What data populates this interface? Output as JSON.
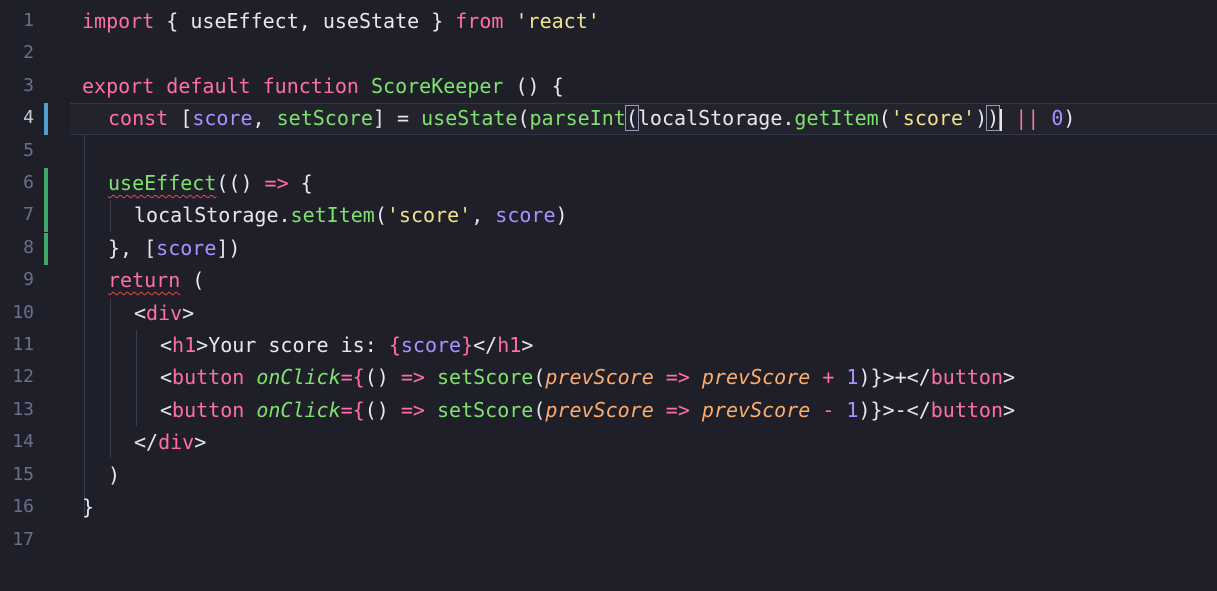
{
  "editor": {
    "lines": [
      {
        "n": "1"
      },
      {
        "n": "2"
      },
      {
        "n": "3"
      },
      {
        "n": "4"
      },
      {
        "n": "5"
      },
      {
        "n": "6"
      },
      {
        "n": "7"
      },
      {
        "n": "8"
      },
      {
        "n": "9"
      },
      {
        "n": "10"
      },
      {
        "n": "11"
      },
      {
        "n": "12"
      },
      {
        "n": "13"
      },
      {
        "n": "14"
      },
      {
        "n": "15"
      },
      {
        "n": "16"
      },
      {
        "n": "17"
      }
    ],
    "code": {
      "l1": {
        "import": "import",
        "p1": " { ",
        "useEffect": "useEffect",
        "comma": ", ",
        "useState": "useState",
        "p2": " } ",
        "from": "from",
        "sp": " ",
        "react": "'react'"
      },
      "l3": {
        "export": "export",
        "default": "default",
        "function": "function",
        "name": "ScoreKeeper",
        "parens": " () {"
      },
      "l4": {
        "const": "const",
        "open": " [",
        "score": "score",
        "comma": ", ",
        "setScore": "setScore",
        "close": "] = ",
        "useState": "useState",
        "paren1": "(",
        "parseInt": "parseInt",
        "paren2": "(",
        "localStorage": "localStorage",
        "dot": ".",
        "getItem": "getItem",
        "paren3": "(",
        "key": "'score'",
        "paren4": ")",
        "paren5": ")",
        "or": " || ",
        "zero": "0",
        "paren6": ")"
      },
      "l6": {
        "useEffect": "useEffect",
        "rest": "(() ",
        "arrow": "=>",
        "brace": " {"
      },
      "l7": {
        "localStorage": "localStorage",
        "dot": ".",
        "setItem": "setItem",
        "p1": "(",
        "key": "'score'",
        "comma": ", ",
        "score": "score",
        "p2": ")"
      },
      "l8": {
        "p1": "}, [",
        "score": "score",
        "p2": "])"
      },
      "l9": {
        "return": "return",
        "rest": " ("
      },
      "l10": {
        "lt": "<",
        "div": "div",
        "gt": ">"
      },
      "l11": {
        "lt": "<",
        "h1": "h1",
        "gt": ">",
        "text": "Your score is: ",
        "b1": "{",
        "score": "score",
        "b2": "}",
        "lt2": "</",
        "h1c": "h1",
        "gt2": ">"
      },
      "l12": {
        "lt": "<",
        "button": "button",
        "sp": " ",
        "onClick": "onClick",
        "eq": "={",
        "paren": "() ",
        "arrow": "=>",
        "sp2": " ",
        "setScore": "setScore",
        "p1": "(",
        "prev1": "prevScore",
        "arrow2": " => ",
        "prev2": "prevScore",
        "op": " + ",
        "one": "1",
        "p2": ")}",
        "gt": ">",
        "label": "+",
        "lt2": "</",
        "buttonc": "button",
        "gt2": ">"
      },
      "l13": {
        "lt": "<",
        "button": "button",
        "sp": " ",
        "onClick": "onClick",
        "eq": "={",
        "paren": "() ",
        "arrow": "=>",
        "sp2": " ",
        "setScore": "setScore",
        "p1": "(",
        "prev1": "prevScore",
        "arrow2": " => ",
        "prev2": "prevScore",
        "op": " - ",
        "one": "1",
        "p2": ")}",
        "gt": ">",
        "label": "-",
        "lt2": "</",
        "buttonc": "button",
        "gt2": ">"
      },
      "l14": {
        "lt": "</",
        "div": "div",
        "gt": ">"
      },
      "l15": {
        "text": ")"
      },
      "l16": {
        "text": "}"
      }
    }
  },
  "colors": {
    "background": "#1f1f29",
    "keyword": "#ff6ea8",
    "function": "#7ee36c",
    "string": "#f0e18a",
    "variable": "#a792ff",
    "parameter": "#ffab6b",
    "git_added": "#3ea86b",
    "git_modified": "#4f9fcf"
  }
}
